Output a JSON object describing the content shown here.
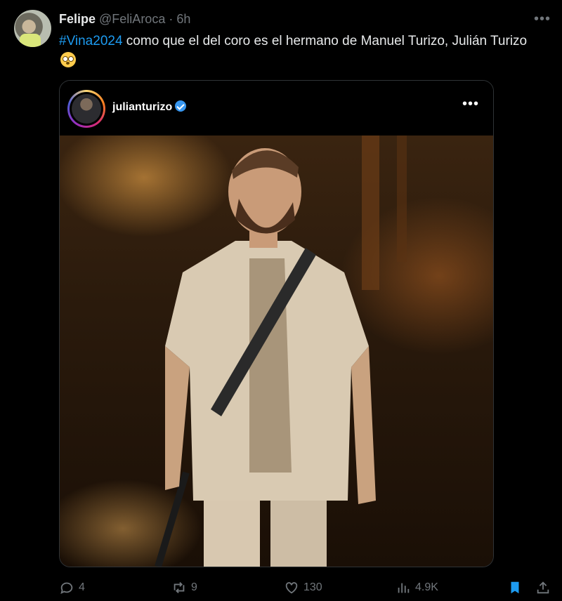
{
  "tweet": {
    "author_name": "Felipe",
    "author_handle": "@FeliAroca",
    "separator": "·",
    "time": "6h",
    "hashtag": "#Vina2024",
    "text": " como que el del coro es el hermano de Manuel Turizo, Julián Turizo ",
    "emoji": "flushed-face"
  },
  "embed": {
    "username": "julianturizo",
    "verified": true
  },
  "actions": {
    "replies": "4",
    "reposts": "9",
    "likes": "130",
    "views": "4.9K"
  },
  "colors": {
    "background": "#000000",
    "text": "#e7e9ea",
    "muted": "#71767b",
    "link": "#1d9bf0",
    "bookmark": "#1d9bf0"
  }
}
